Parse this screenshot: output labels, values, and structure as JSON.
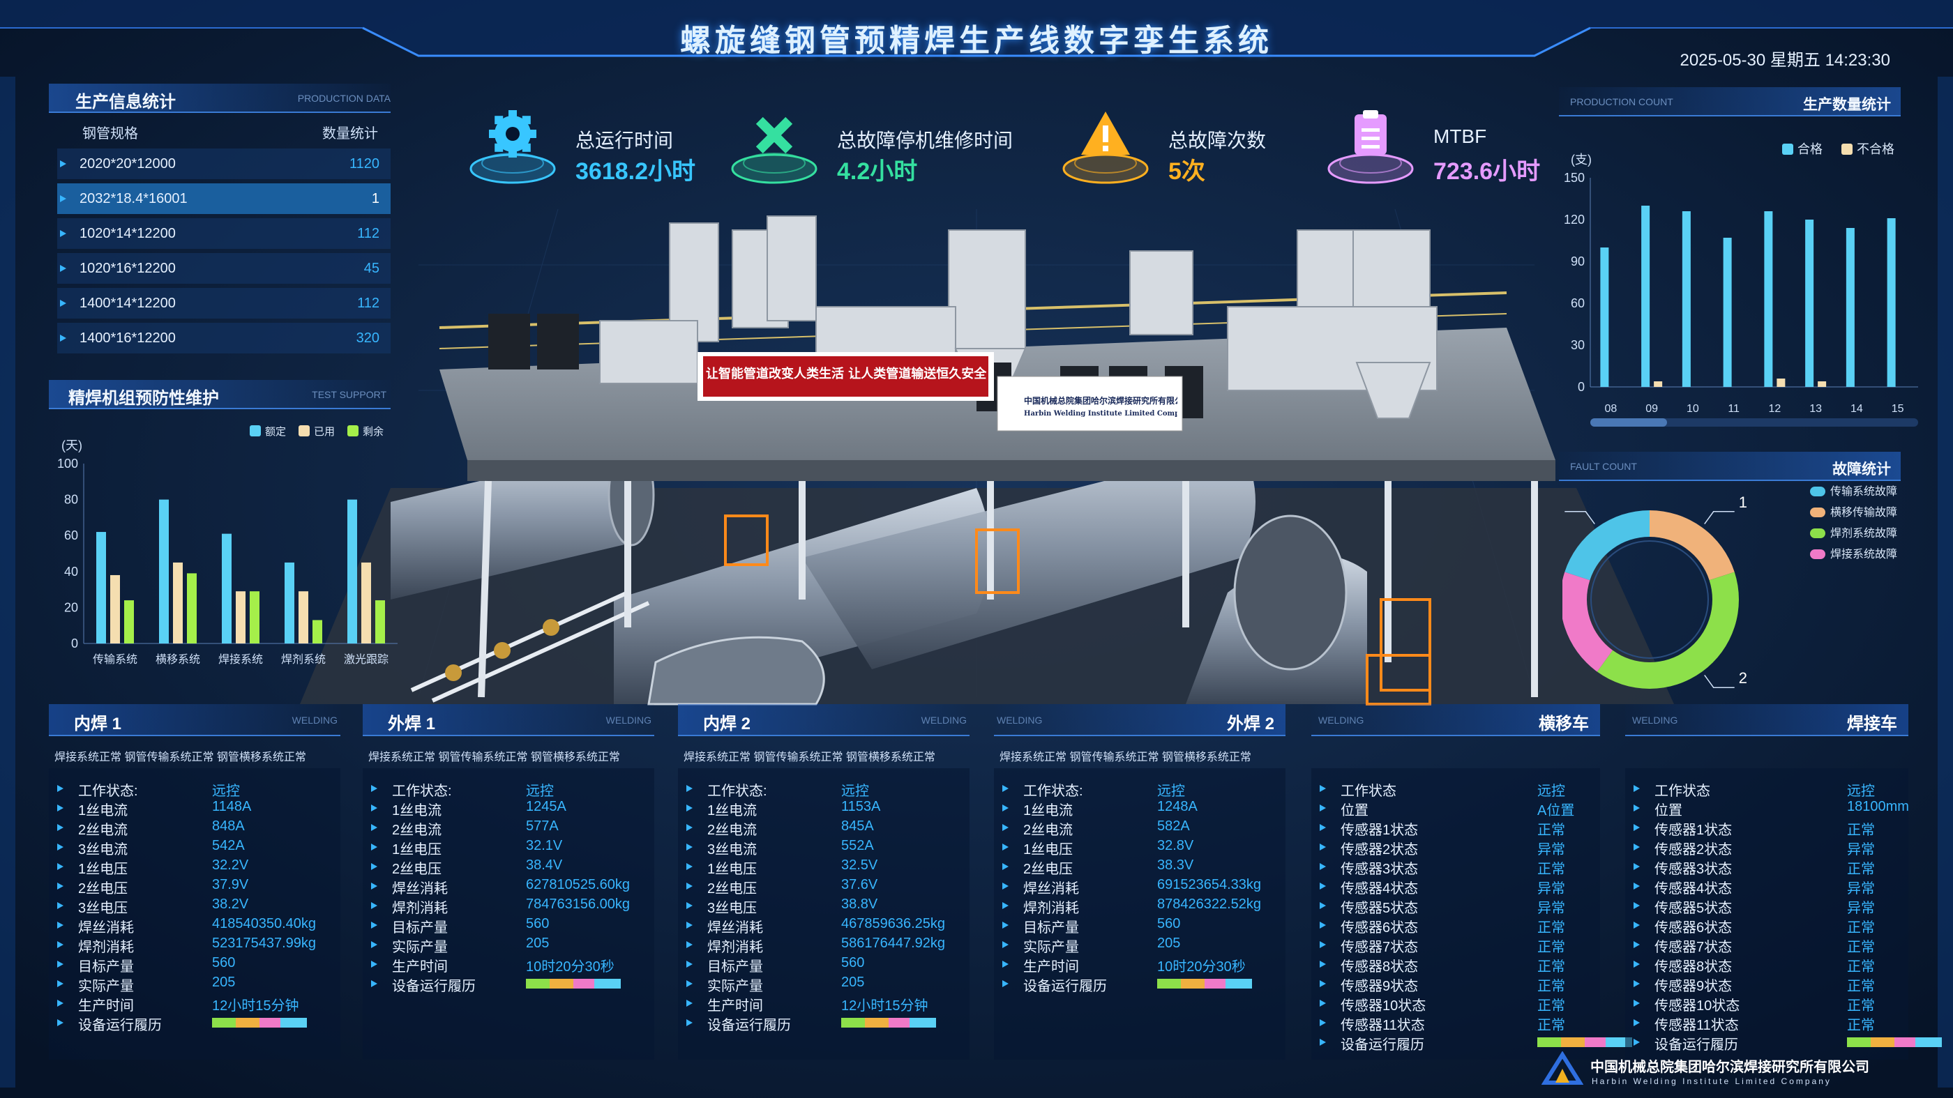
{
  "header": {
    "title": "螺旋缝钢管预精焊生产线数字孪生系统",
    "datetime": "2025-05-30 星期五 14:23:30"
  },
  "production_info": {
    "title": "生产信息统计",
    "subtitle": "PRODUCTION DATA",
    "col_spec": "钢管规格",
    "col_count": "数量统计",
    "rows": [
      {
        "spec": "2020*20*12000",
        "count": "1120"
      },
      {
        "spec": "2032*18.4*16001",
        "count": "1"
      },
      {
        "spec": "1020*14*12200",
        "count": "112"
      },
      {
        "spec": "1020*16*12200",
        "count": "45"
      },
      {
        "spec": "1400*14*12200",
        "count": "112"
      },
      {
        "spec": "1400*16*12200",
        "count": "320"
      }
    ]
  },
  "kpis": [
    {
      "label": "总运行时间",
      "value": "3618.2小时",
      "color": "#38c6ff",
      "icon": "gear-icon"
    },
    {
      "label": "总故障停机维修时间",
      "value": "4.2小时",
      "color": "#35e0a0",
      "icon": "hammer-wrench-icon"
    },
    {
      "label": "总故障次数",
      "value": "5次",
      "color": "#ffb020",
      "icon": "warning-icon"
    },
    {
      "label": "MTBF",
      "value": "723.6小时",
      "color": "#e59bff",
      "icon": "clipboard-icon"
    }
  ],
  "maintenance": {
    "title": "精焊机组预防性维护",
    "subtitle": "TEST SUPPORT",
    "chart_data": {
      "type": "bar",
      "categories": [
        "传输系统",
        "横移系统",
        "焊接系统",
        "焊剂系统",
        "激光跟踪"
      ],
      "series": [
        {
          "name": "额定",
          "color": "#5ad1f5",
          "values": [
            62,
            80,
            61,
            45,
            80
          ]
        },
        {
          "name": "已用",
          "color": "#f5deb0",
          "values": [
            38,
            45,
            29,
            29,
            45
          ]
        },
        {
          "name": "剩余",
          "color": "#a5ef4a",
          "values": [
            24,
            39,
            29,
            13,
            24
          ]
        }
      ],
      "ylabel": "(天)",
      "yticks": [
        0,
        20,
        40,
        60,
        80,
        100
      ],
      "ylim": [
        0,
        100
      ]
    }
  },
  "production_count": {
    "title": "生产数量统计",
    "subtitle": "PRODUCTION COUNT",
    "chart_data": {
      "type": "bar",
      "categories": [
        "08",
        "09",
        "10",
        "11",
        "12",
        "13",
        "14",
        "15"
      ],
      "series": [
        {
          "name": "合格",
          "color": "#5ad1f5",
          "values": [
            100,
            130,
            126,
            107,
            126,
            120,
            114,
            121
          ]
        },
        {
          "name": "不合格",
          "color": "#f5deb0",
          "values": [
            0,
            4,
            0,
            0,
            6,
            4,
            0,
            0
          ]
        }
      ],
      "ylabel": "(支)",
      "yticks": [
        0,
        30,
        60,
        90,
        120,
        150
      ],
      "ylim": [
        0,
        150
      ]
    }
  },
  "fault": {
    "title": "故障统计",
    "subtitle": "FAULT COUNT",
    "chart_data": {
      "type": "pie",
      "labels": [
        "传输系统故障",
        "横移传输故障",
        "焊剂系统故障",
        "焊接系统故障"
      ],
      "colors": [
        "#4ec4e8",
        "#f0b27a",
        "#8de04a",
        "#f07ac8"
      ],
      "values": [
        1,
        1,
        2,
        1
      ]
    }
  },
  "banner": {
    "slogan": "让智能管道改变人类生活 让人类管道输送恒久安全",
    "company": "中国机械总院集团哈尔滨焊接研究所有限公司",
    "company_en": "Harbin Welding Institute Limited Company"
  },
  "panels": [
    {
      "title": "内焊 1",
      "subtitle": "WELDING",
      "status": "焊接系统正常   钢管传输系统正常   钢管横移系统正常",
      "items": [
        {
          "k": "工作状态:",
          "v": "远控"
        },
        {
          "k": "1丝电流",
          "v": "1148A"
        },
        {
          "k": "2丝电流",
          "v": "848A"
        },
        {
          "k": "3丝电流",
          "v": "542A"
        },
        {
          "k": "1丝电压",
          "v": "32.2V"
        },
        {
          "k": "2丝电压",
          "v": "37.9V"
        },
        {
          "k": "3丝电压",
          "v": "38.2V"
        },
        {
          "k": "焊丝消耗",
          "v": "418540350.40kg"
        },
        {
          "k": "焊剂消耗",
          "v": "523175437.99kg"
        },
        {
          "k": "目标产量",
          "v": "560"
        },
        {
          "k": "实际产量",
          "v": "205"
        },
        {
          "k": "生产时间",
          "v": "12小时15分钟"
        },
        {
          "k": "设备运行履历",
          "v": ""
        }
      ]
    },
    {
      "title": "外焊 1",
      "subtitle": "WELDING",
      "status": "焊接系统正常   钢管传输系统正常   钢管横移系统正常",
      "items": [
        {
          "k": "工作状态:",
          "v": "远控"
        },
        {
          "k": "1丝电流",
          "v": "1245A"
        },
        {
          "k": "2丝电流",
          "v": "577A"
        },
        {
          "k": "1丝电压",
          "v": "32.1V"
        },
        {
          "k": "2丝电压",
          "v": "38.4V"
        },
        {
          "k": "焊丝消耗",
          "v": "627810525.60kg"
        },
        {
          "k": "焊剂消耗",
          "v": "784763156.00kg"
        },
        {
          "k": "目标产量",
          "v": "560"
        },
        {
          "k": "实际产量",
          "v": "205"
        },
        {
          "k": "生产时间",
          "v": "10时20分30秒"
        },
        {
          "k": "设备运行履历",
          "v": ""
        }
      ]
    },
    {
      "title": "内焊 2",
      "subtitle": "WELDING",
      "status": "焊接系统正常   钢管传输系统正常   钢管横移系统正常",
      "items": [
        {
          "k": "工作状态:",
          "v": "远控"
        },
        {
          "k": "1丝电流",
          "v": "1153A"
        },
        {
          "k": "2丝电流",
          "v": "845A"
        },
        {
          "k": "3丝电流",
          "v": "552A"
        },
        {
          "k": "1丝电压",
          "v": "32.5V"
        },
        {
          "k": "2丝电压",
          "v": "37.6V"
        },
        {
          "k": "3丝电压",
          "v": "38.8V"
        },
        {
          "k": "焊丝消耗",
          "v": "467859636.25kg"
        },
        {
          "k": "焊剂消耗",
          "v": "586176447.92kg"
        },
        {
          "k": "目标产量",
          "v": "560"
        },
        {
          "k": "实际产量",
          "v": "205"
        },
        {
          "k": "生产时间",
          "v": "12小时15分钟"
        },
        {
          "k": "设备运行履历",
          "v": ""
        }
      ]
    },
    {
      "title": "外焊 2",
      "subtitle": "WELDING",
      "status": "焊接系统正常   钢管传输系统正常   钢管横移系统正常",
      "items": [
        {
          "k": "工作状态:",
          "v": "远控"
        },
        {
          "k": "1丝电流",
          "v": "1248A"
        },
        {
          "k": "2丝电流",
          "v": "582A"
        },
        {
          "k": "1丝电压",
          "v": "32.8V"
        },
        {
          "k": "2丝电压",
          "v": "38.3V"
        },
        {
          "k": "焊丝消耗",
          "v": "691523654.33kg"
        },
        {
          "k": "焊剂消耗",
          "v": "878426322.52kg"
        },
        {
          "k": "目标产量",
          "v": "560"
        },
        {
          "k": "实际产量",
          "v": "205"
        },
        {
          "k": "生产时间",
          "v": "10时20分30秒"
        },
        {
          "k": "设备运行履历",
          "v": ""
        }
      ]
    },
    {
      "title": "横移车",
      "subtitle": "WELDING",
      "status": "",
      "items": [
        {
          "k": "工作状态",
          "v": "远控"
        },
        {
          "k": "位置",
          "v": "A位置"
        },
        {
          "k": "传感器1状态",
          "v": "正常"
        },
        {
          "k": "传感器2状态",
          "v": "异常"
        },
        {
          "k": "传感器3状态",
          "v": "正常"
        },
        {
          "k": "传感器4状态",
          "v": "异常"
        },
        {
          "k": "传感器5状态",
          "v": "异常"
        },
        {
          "k": "传感器6状态",
          "v": "正常"
        },
        {
          "k": "传感器7状态",
          "v": "正常"
        },
        {
          "k": "传感器8状态",
          "v": "正常"
        },
        {
          "k": "传感器9状态",
          "v": "正常"
        },
        {
          "k": "传感器10状态",
          "v": "正常"
        },
        {
          "k": "传感器11状态",
          "v": "正常"
        },
        {
          "k": "设备运行履历",
          "v": ""
        }
      ]
    },
    {
      "title": "焊接车",
      "subtitle": "WELDING",
      "status": "",
      "items": [
        {
          "k": "工作状态",
          "v": "远控"
        },
        {
          "k": "位置",
          "v": "18100mm"
        },
        {
          "k": "传感器1状态",
          "v": "正常"
        },
        {
          "k": "传感器2状态",
          "v": "异常"
        },
        {
          "k": "传感器3状态",
          "v": "正常"
        },
        {
          "k": "传感器4状态",
          "v": "异常"
        },
        {
          "k": "传感器5状态",
          "v": "异常"
        },
        {
          "k": "传感器6状态",
          "v": "正常"
        },
        {
          "k": "传感器7状态",
          "v": "正常"
        },
        {
          "k": "传感器8状态",
          "v": "正常"
        },
        {
          "k": "传感器9状态",
          "v": "正常"
        },
        {
          "k": "传感器10状态",
          "v": "正常"
        },
        {
          "k": "传感器11状态",
          "v": "正常"
        },
        {
          "k": "设备运行履历",
          "v": ""
        }
      ]
    }
  ],
  "history_colors": [
    "#8de04a",
    "#f0b040",
    "#f07ac8",
    "#5ad1f5"
  ],
  "footer": {
    "company": "中国机械总院集团哈尔滨焊接研究所有限公司",
    "company_en": "Harbin Welding Institute Limited Company"
  }
}
